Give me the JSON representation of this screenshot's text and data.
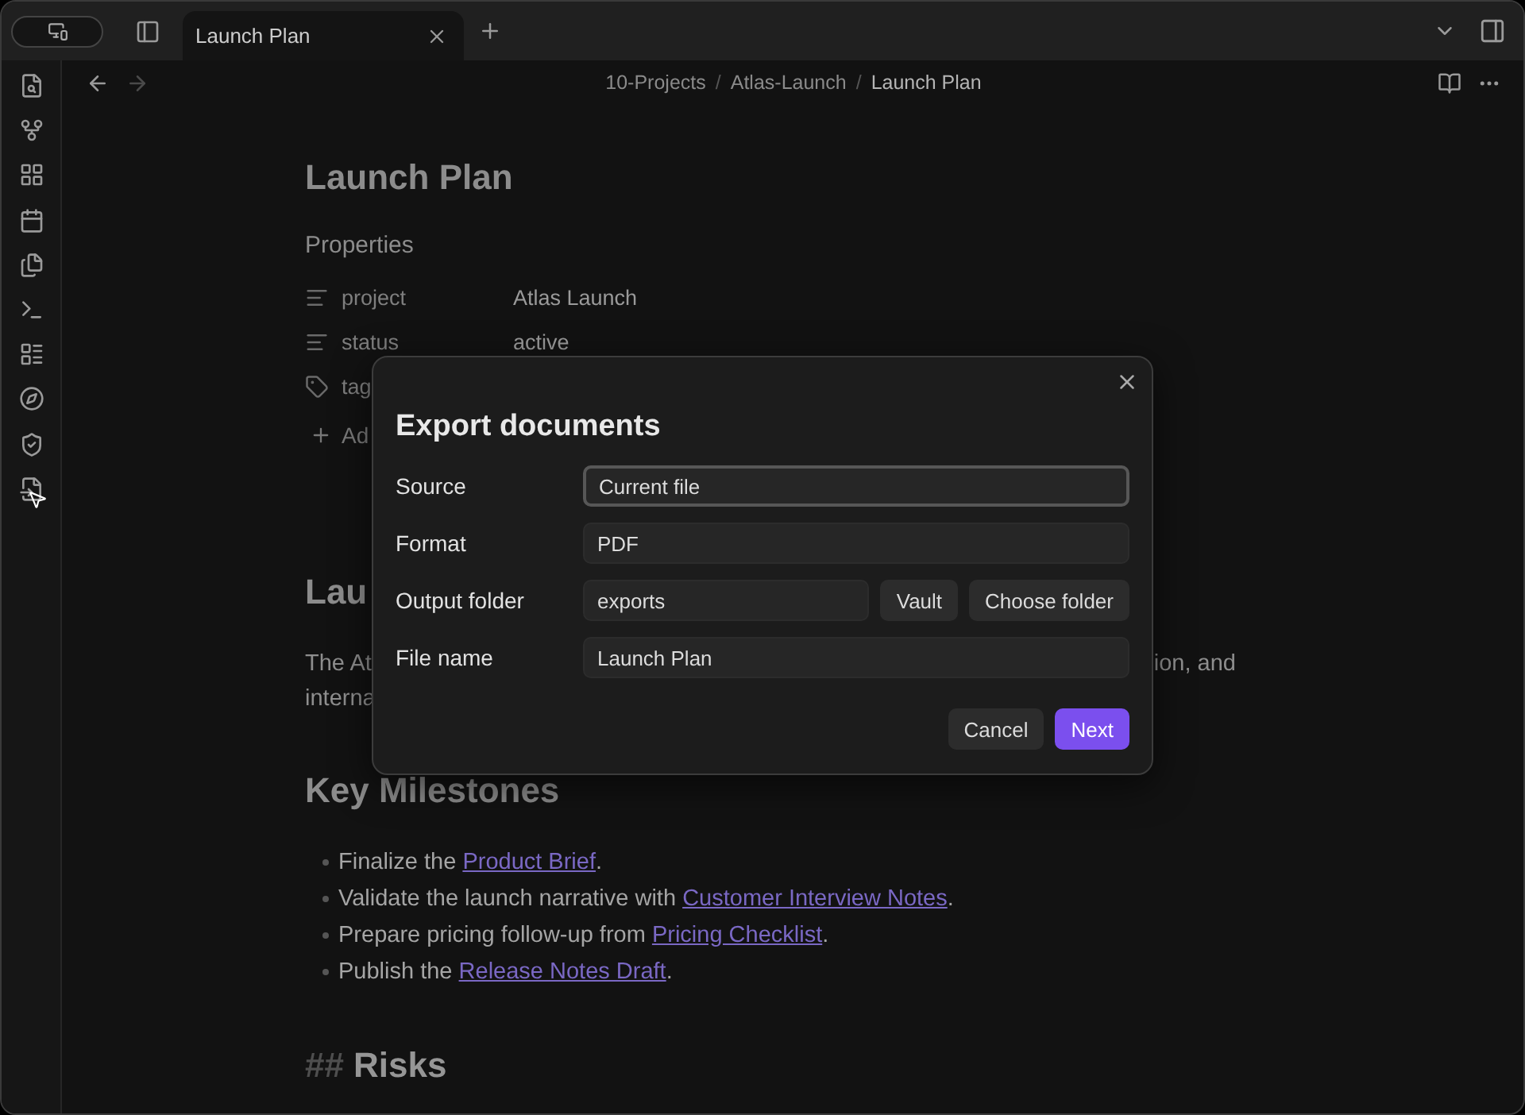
{
  "title_bar": {
    "tabs": [
      {
        "label": "Launch Plan",
        "selected": true
      }
    ]
  },
  "nav": {
    "back": {
      "disabled": false
    },
    "forward": {
      "disabled": true
    },
    "separator": "/",
    "breadcrumbs": [
      "10-Projects",
      "Atlas-Launch",
      "Launch Plan"
    ]
  },
  "note": {
    "title": "Launch Plan",
    "properties_heading": "Properties",
    "properties": [
      {
        "kind": "text",
        "key": "project",
        "value": "Atlas Launch"
      },
      {
        "kind": "text",
        "key": "status",
        "value": "active"
      },
      {
        "kind": "tags",
        "key": "tag"
      }
    ],
    "add_property": "Ad",
    "section_heading": "Lau",
    "paragraph": {
      "line_1_start": "The At",
      "line_1_end": "ion, and",
      "line_2_start": "interna"
    },
    "milestones_heading": "Key Milestones",
    "milestones": [
      {
        "before": "Finalize the ",
        "link": "Product Brief",
        "after": "."
      },
      {
        "before": "Validate the launch narrative with ",
        "link": "Customer Interview Notes",
        "after": "."
      },
      {
        "before": "Prepare pricing follow-up from ",
        "link": "Pricing Checklist",
        "after": "."
      },
      {
        "before": "Publish the ",
        "link": "Release Notes Draft",
        "after": "."
      }
    ],
    "risks_heading": {
      "marker": "##",
      "text": "Risks"
    }
  },
  "dialog": {
    "title": "Export documents",
    "fields": [
      {
        "kind": "select",
        "label": "Source",
        "value": "Current file",
        "focused": true
      },
      {
        "kind": "select",
        "label": "Format",
        "value": "PDF",
        "focused": false
      },
      {
        "kind": "folder",
        "label": "Output folder",
        "value": "exports",
        "buttons": [
          "Vault",
          "Choose folder"
        ]
      },
      {
        "kind": "text",
        "label": "File name",
        "value": "Launch Plan"
      }
    ],
    "buttons": [
      {
        "label": "Cancel",
        "primary": false
      },
      {
        "label": "Next",
        "primary": true
      }
    ]
  }
}
